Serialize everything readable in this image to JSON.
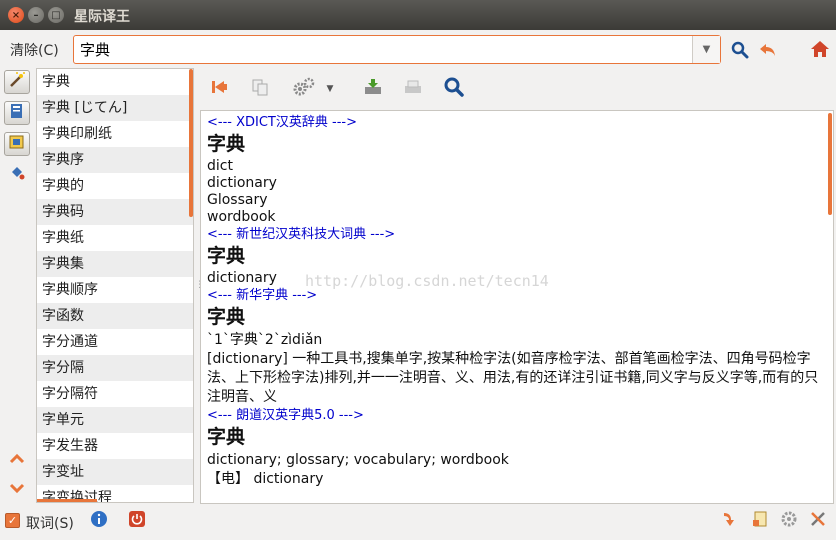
{
  "window": {
    "title": "星际译王"
  },
  "search": {
    "clear_label": "清除(C)",
    "query": "字典"
  },
  "word_list": [
    "字典",
    "字典 [じてん]",
    "字典印刷纸",
    "字典序",
    "字典的",
    "字典码",
    "字典纸",
    "字典集",
    "字典顺序",
    "字函数",
    "字分通道",
    "字分隔",
    "字分隔符",
    "字单元",
    "字发生器",
    "字变址",
    "字变换过程"
  ],
  "results": {
    "dict1": {
      "header": "<--- XDICT汉英辞典 --->",
      "headword": "字典",
      "lines": [
        "dict",
        "dictionary",
        "Glossary",
        "wordbook"
      ]
    },
    "dict2": {
      "header": "<--- 新世纪汉英科技大词典 --->",
      "headword": "字典",
      "lines": [
        "dictionary"
      ]
    },
    "dict3": {
      "header": "<--- 新华字典 --->",
      "headword": "字典",
      "pinyin": "`1`字典`2`zìdiǎn",
      "definition": "[dictionary] 一种工具书,搜集单字,按某种检字法(如音序检字法、部首笔画检字法、四角号码检字法、上下形检字法)排列,并一一注明音、义、用法,有的还详注引证书籍,同义字与反义字等,而有的只注明音、义"
    },
    "dict4": {
      "header": "<--- 朗道汉英字典5.0 --->",
      "headword": "字典",
      "lines": [
        "dictionary; glossary; vocabulary; wordbook",
        "【电】 dictionary"
      ]
    }
  },
  "watermark": "http://blog.csdn.net/tecn14",
  "bottom": {
    "scan_label": "取词(S)",
    "scan_checked": true
  },
  "colors": {
    "accent": "#e8753a",
    "dict_header": "#0000cc",
    "titlebar": "#3c3b37"
  }
}
